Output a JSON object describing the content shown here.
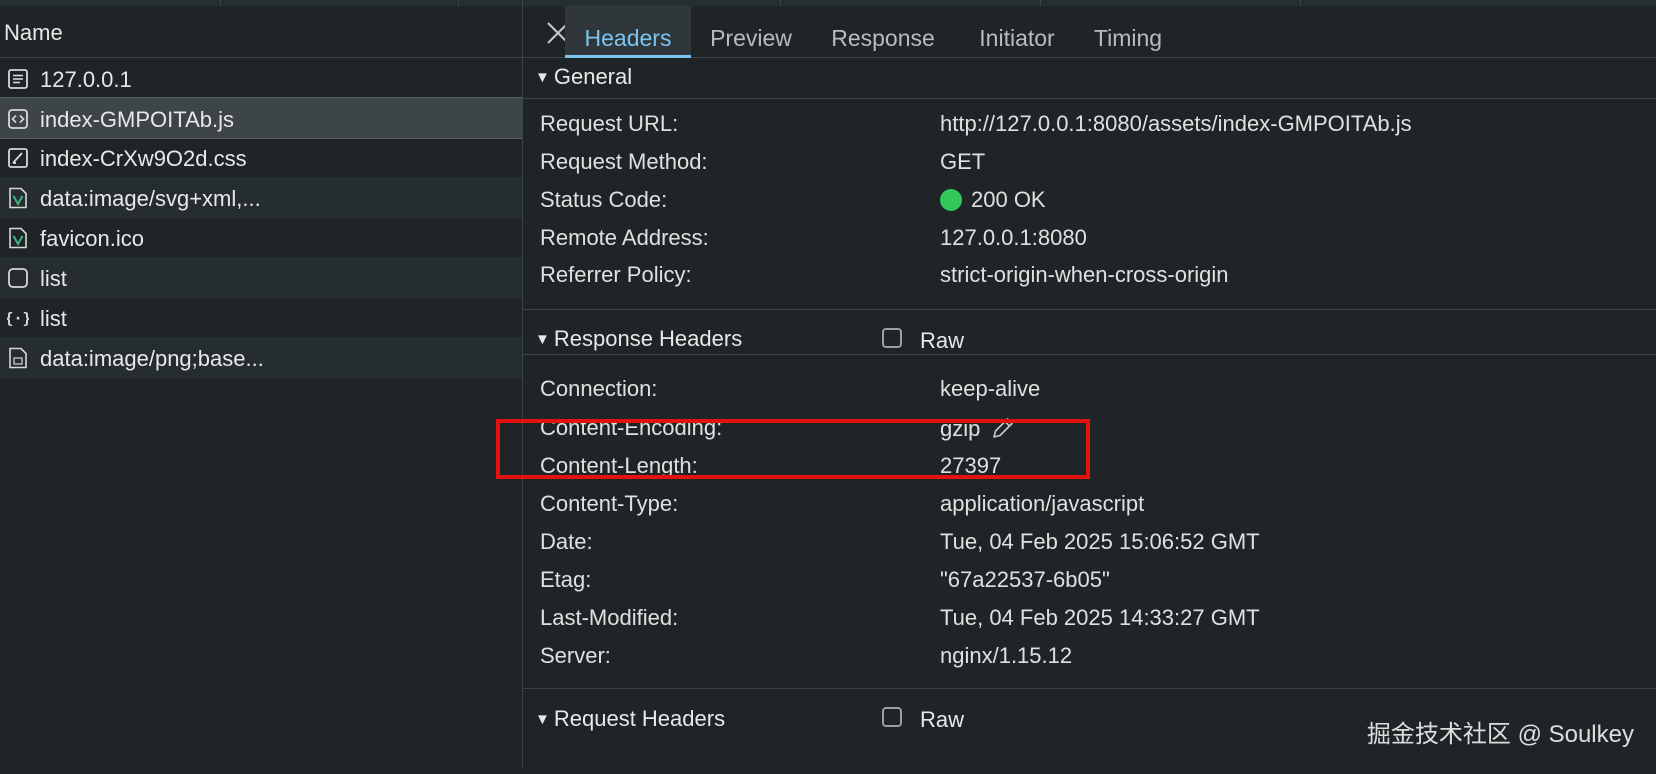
{
  "left": {
    "header": "Name",
    "requests": [
      {
        "label": "127.0.0.1",
        "icon": "document-icon"
      },
      {
        "label": "index-GMPOITAb.js",
        "icon": "script-icon"
      },
      {
        "label": "index-CrXw9O2d.css",
        "icon": "stylesheet-icon"
      },
      {
        "label": "data:image/svg+xml,...",
        "icon": "vue-file-icon"
      },
      {
        "label": "favicon.ico",
        "icon": "vue-file-icon"
      },
      {
        "label": "list",
        "icon": "blank-icon"
      },
      {
        "label": "list",
        "icon": "json-icon"
      },
      {
        "label": "data:image/png;base...",
        "icon": "image-file-icon"
      }
    ]
  },
  "tabs": [
    "Headers",
    "Preview",
    "Response",
    "Initiator",
    "Timing"
  ],
  "active_tab": "Headers",
  "general": {
    "title": "General",
    "rows": [
      {
        "key": "Request URL:",
        "value": "http://127.0.0.1:8080/assets/index-GMPOITAb.js"
      },
      {
        "key": "Request Method:",
        "value": "GET"
      },
      {
        "key": "Status Code:",
        "value": "200 OK"
      },
      {
        "key": "Remote Address:",
        "value": "127.0.0.1:8080"
      },
      {
        "key": "Referrer Policy:",
        "value": "strict-origin-when-cross-origin"
      }
    ]
  },
  "response_headers": {
    "title": "Response Headers",
    "raw_label": "Raw",
    "rows": [
      {
        "key": "Connection:",
        "value": "keep-alive"
      },
      {
        "key": "Content-Encoding:",
        "value": "gzip"
      },
      {
        "key": "Content-Length:",
        "value": "27397"
      },
      {
        "key": "Content-Type:",
        "value": "application/javascript"
      },
      {
        "key": "Date:",
        "value": "Tue, 04 Feb 2025 15:06:52 GMT"
      },
      {
        "key": "Etag:",
        "value": "\"67a22537-6b05\""
      },
      {
        "key": "Last-Modified:",
        "value": "Tue, 04 Feb 2025 14:33:27 GMT"
      },
      {
        "key": "Server:",
        "value": "nginx/1.15.12"
      }
    ]
  },
  "request_headers": {
    "title": "Request Headers",
    "raw_label": "Raw"
  },
  "watermark": "掘金技术社区 @ Soulkey",
  "colors": {
    "active_tab": "#7cc4f0",
    "status_ok": "#34c759",
    "highlight": "#e41111",
    "vue_green": "#41b883"
  }
}
